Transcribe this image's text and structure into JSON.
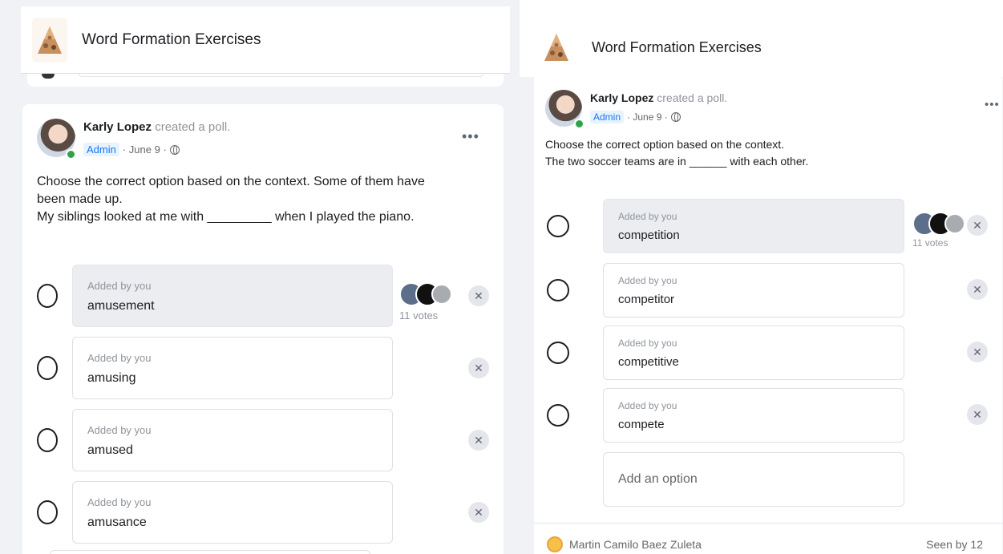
{
  "left": {
    "group_title": "Word Formation Exercises",
    "post": {
      "author": "Karly Lopez",
      "action": "created a poll.",
      "badge": "Admin",
      "date": "· June 9 ·",
      "text": "Choose the correct option based on the context. Some of them have\nbeen made up.\nMy siblings looked at me with _________ when I played the piano.",
      "options": [
        {
          "sub": "Added by you",
          "label": "amusement",
          "votes": "11 votes",
          "voted": true
        },
        {
          "sub": "Added by you",
          "label": "amusing",
          "voted": false
        },
        {
          "sub": "Added by you",
          "label": "amused",
          "voted": false
        },
        {
          "sub": "Added by you",
          "label": "amusance",
          "voted": false
        }
      ]
    }
  },
  "right": {
    "group_title": "Word Formation Exercises",
    "post": {
      "author": "Karly Lopez",
      "action": "created a poll.",
      "badge": "Admin",
      "date": "· June 9 ·",
      "text": "Choose the correct option based on the context.\nThe two soccer teams are in ______ with each other.",
      "options": [
        {
          "sub": "Added by you",
          "label": "competition",
          "votes": "11 votes",
          "voted": true
        },
        {
          "sub": "Added by you",
          "label": "competitor",
          "voted": false
        },
        {
          "sub": "Added by you",
          "label": "competitive",
          "voted": false
        },
        {
          "sub": "Added by you",
          "label": "compete",
          "voted": false
        }
      ],
      "add_option": "Add an option",
      "seen_by_name": "Martin Camilo Baez Zuleta",
      "seen_by_count": "Seen by 12"
    }
  },
  "icons": {
    "more": "more-options-icon",
    "remove": "remove-option-icon",
    "globe": "globe-icon"
  },
  "colors": {
    "admin_badge": "#1877f2",
    "online": "#31a24c",
    "voted_option_bg": "#ebedf0"
  }
}
